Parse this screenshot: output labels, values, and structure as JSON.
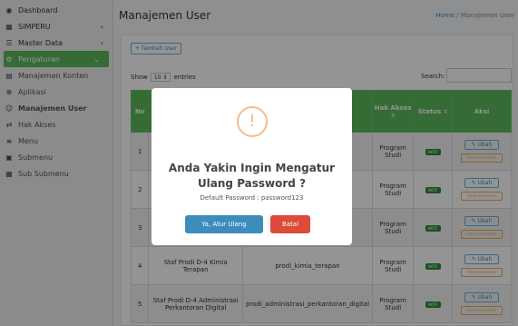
{
  "sidebar": {
    "items": [
      {
        "label": "Dashboard",
        "icon": "dashboard-icon",
        "glyph": "◉"
      },
      {
        "label": "SIMPERU",
        "icon": "building-icon",
        "glyph": "▦",
        "caret": "‹"
      },
      {
        "label": "Master Data",
        "icon": "database-icon",
        "glyph": "☰",
        "caret": "‹"
      },
      {
        "label": "Pengaturan",
        "icon": "gears-icon",
        "glyph": "⚙",
        "caret": "⌄"
      },
      {
        "label": "Manajemen Konten",
        "icon": "content-icon",
        "glyph": "▤"
      },
      {
        "label": "Aplikasi",
        "icon": "globe-icon",
        "glyph": "⊕"
      },
      {
        "label": "Manajemen User",
        "icon": "users-icon",
        "glyph": "☺"
      },
      {
        "label": "Hak Akses",
        "icon": "access-icon",
        "glyph": "⇄"
      },
      {
        "label": "Menu",
        "icon": "menu-icon",
        "glyph": "≡"
      },
      {
        "label": "Submenu",
        "icon": "submenu-icon",
        "glyph": "▣"
      },
      {
        "label": "Sub Submenu",
        "icon": "subsubmenu-icon",
        "glyph": "▦"
      }
    ]
  },
  "header": {
    "title": "Manajemen User",
    "breadcrumb_home": "Home",
    "breadcrumb_sep": "/",
    "breadcrumb_current": "Manajemen User"
  },
  "toolbar": {
    "add_label": "+ Tambah User",
    "show_label": "Show",
    "show_value": "10",
    "entries_label": "entries",
    "search_label": "Search:"
  },
  "table": {
    "columns": [
      "No",
      "Hak Akses",
      "Status",
      "Aksi"
    ],
    "rows": [
      {
        "no": "1",
        "nama": "",
        "username": "",
        "akses": "Program Studi",
        "status": "AKTIF"
      },
      {
        "no": "2",
        "nama": "",
        "username": "",
        "akses": "Program Studi",
        "status": "AKTIF"
      },
      {
        "no": "3",
        "nama": "",
        "username": "",
        "akses": "Program Studi",
        "status": "AKTIF"
      },
      {
        "no": "4",
        "nama": "Staf Prodi D-4 Kimia Terapan",
        "username": "prodi_kimia_terapan",
        "akses": "Program Studi",
        "status": "AKTIF"
      },
      {
        "no": "5",
        "nama": "Staf Prodi D-4 Administrasi Perkantoran Digital",
        "username": "prodi_administrasi_perkantoran_digital",
        "akses": "Program Studi",
        "status": "AKTIF"
      }
    ],
    "edit_label": "Ubah",
    "reset_label": "Reset Password"
  },
  "modal": {
    "icon": "!",
    "title": "Anda Yakin Ingin Mengatur Ulang Password ?",
    "subtitle": "Default Password : password123",
    "confirm_label": "Ya, Atur Ulang Password!",
    "cancel_label": "Batal"
  },
  "colors": {
    "accent": "#5cb85c",
    "primary": "#3c8dbc",
    "danger": "#dd4b39",
    "warning": "#f8bb86"
  }
}
